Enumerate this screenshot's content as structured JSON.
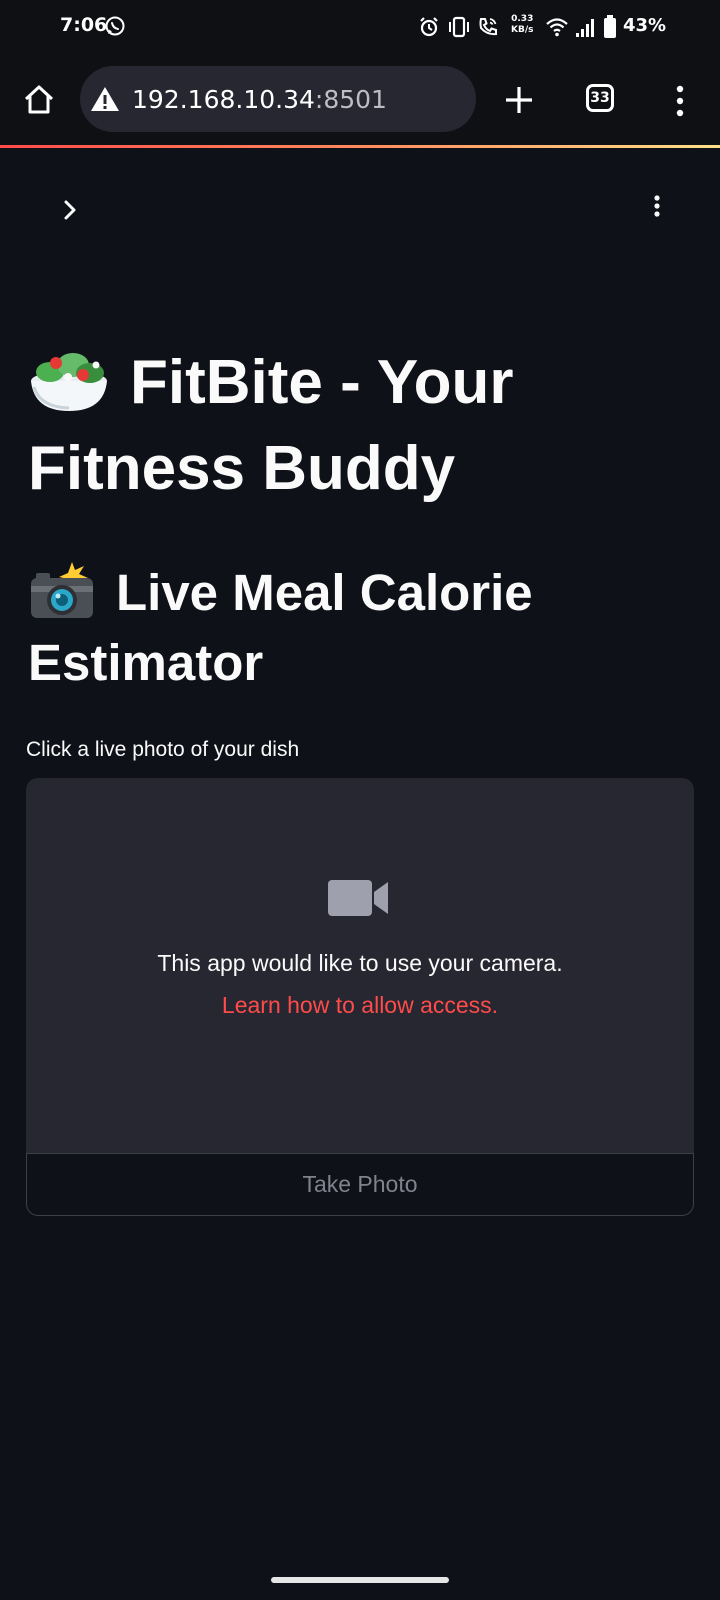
{
  "status_bar": {
    "time": "7:06",
    "net_speed_value": "0.33",
    "net_speed_unit": "KB/s",
    "battery_pct": "43%",
    "icons": [
      "whatsapp-icon",
      "alarm-icon",
      "vibrate-icon",
      "wifi-call-icon",
      "wifi-icon",
      "signal-icon",
      "battery-icon"
    ]
  },
  "browser": {
    "url_host": "192.168.10.34",
    "url_port": ":8501",
    "tab_count": "33",
    "icons": [
      "home-icon",
      "warning-icon",
      "plus-icon",
      "more-vert-icon"
    ]
  },
  "page": {
    "title_emoji": "salad",
    "title": "FitBite - Your Fitness Buddy",
    "subtitle_emoji": "camera-with-flash",
    "subtitle": "Live Meal Calorie Estimator",
    "camera_input": {
      "label": "Click a live photo of your dish",
      "message": "This app would like to use your camera.",
      "link": "Learn how to allow access.",
      "button": "Take Photo"
    }
  },
  "colors": {
    "background": "#0e1117",
    "surface": "#262730",
    "accent_red": "#ff4b4b",
    "text": "#fafafa",
    "disabled_text": "#80838e"
  }
}
